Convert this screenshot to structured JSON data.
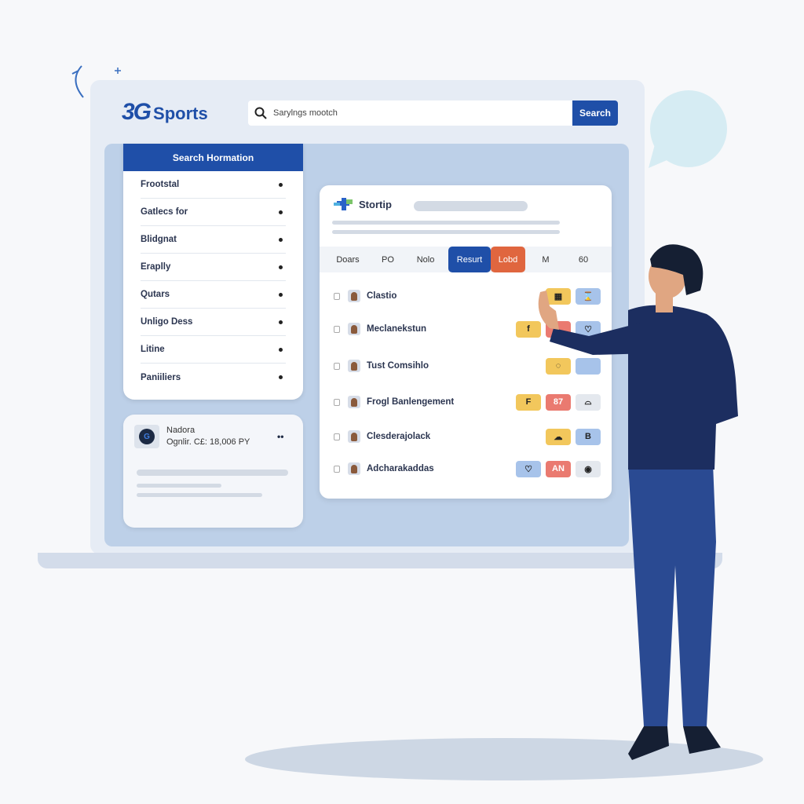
{
  "logo": {
    "mark": "3G",
    "text": "Sports"
  },
  "search": {
    "value": "Sarylngs mootch",
    "button": "Search"
  },
  "sidebar": {
    "title": "Search Hormation",
    "items": [
      "Frootstal",
      "Gatlecs for",
      "Blidgnat",
      "Eraplly",
      "Qutars",
      "Unligo Dess",
      "Litine",
      "Paniiliers"
    ]
  },
  "profile_card": {
    "name": "Nadora",
    "detail": "Ognlir. C£: 18,006 PY",
    "more": "••"
  },
  "main_card": {
    "title": "Stortip",
    "tabs": [
      {
        "label": "Doars"
      },
      {
        "label": "PO"
      },
      {
        "label": "Nolo"
      },
      {
        "label": "Resurt",
        "active": true
      },
      {
        "label": "Lobd",
        "highlight": true
      },
      {
        "label": "M"
      },
      {
        "label": "60"
      }
    ],
    "rows": [
      {
        "name": "Clastio",
        "badges": [
          {
            "text": "▦",
            "color": "yellow"
          },
          {
            "text": "⌛",
            "color": "blue"
          }
        ]
      },
      {
        "name": "Meclanekstun",
        "badges": [
          {
            "text": "f",
            "color": "yellow"
          },
          {
            "text": "",
            "color": "red"
          },
          {
            "text": "♡",
            "color": "blue"
          }
        ]
      },
      {
        "name": "Tust Comsihlo",
        "badges": [
          {
            "text": "◌",
            "color": "yellow"
          },
          {
            "text": "",
            "color": "blue"
          }
        ]
      },
      {
        "name": "Frogl Banlengement",
        "badges": [
          {
            "text": "F",
            "color": "yellow"
          },
          {
            "text": "87",
            "color": "red"
          },
          {
            "text": "⌓",
            "color": "gray"
          }
        ]
      },
      {
        "name": "Clesderajolack",
        "badges": [
          {
            "text": "☁",
            "color": "yellow"
          },
          {
            "text": "B",
            "color": "blue"
          }
        ]
      },
      {
        "name": "Adcharakaddas",
        "badges": [
          {
            "text": "♡",
            "color": "blue"
          },
          {
            "text": "AN",
            "color": "red"
          },
          {
            "text": "◉",
            "color": "gray"
          }
        ]
      }
    ]
  },
  "colors": {
    "brand": "#1f4fa8",
    "accent": "#e0663f",
    "panel": "#bdd0e8"
  }
}
